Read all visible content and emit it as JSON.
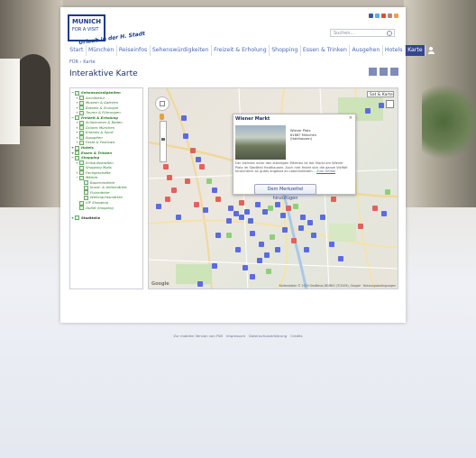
{
  "brand": {
    "logo_line1": "MUNICH",
    "logo_line2": "FOR A VISIT",
    "slogan": "Urlaub in der H. Stadt"
  },
  "colors": {
    "brand_blue": "#33478f",
    "link_blue": "#4b67b5",
    "tree_green": "#2a7a2a",
    "marker_blue": "#5b6be0",
    "marker_red": "#e0625a",
    "marker_green": "#8fce7a"
  },
  "social": [
    "facebook-icon",
    "twitter-icon",
    "googleplus-icon",
    "xing-icon",
    "rss-icon"
  ],
  "search": {
    "placeholder": "Suchen..."
  },
  "nav": {
    "items": [
      "Start",
      "München",
      "Reiseinfos",
      "Sehenswürdigkeiten",
      "Freizeit & Erholung",
      "Shopping",
      "Essen & Trinken",
      "Ausgehen",
      "Hotels",
      "Karte"
    ],
    "active": "Karte"
  },
  "breadcrumb": "FÜR › Karte",
  "page_title": "Interaktive Karte",
  "tree": [
    {
      "label": "Sehenswürdigkeiten",
      "level": 0,
      "toggle": "−"
    },
    {
      "label": "Architektur",
      "level": 1,
      "toggle": "+"
    },
    {
      "label": "Museen & Galerien",
      "level": 1,
      "toggle": "+"
    },
    {
      "label": "Botanik & Zoologie",
      "level": 1,
      "toggle": "+"
    },
    {
      "label": "Touren & Führungen",
      "level": 1,
      "toggle": "+"
    },
    {
      "label": "Freizeit & Erholung",
      "level": 0,
      "toggle": "−"
    },
    {
      "label": "Schwimmen & Baden",
      "level": 1,
      "toggle": "+"
    },
    {
      "label": "Grünes München",
      "level": 1,
      "toggle": "+"
    },
    {
      "label": "Erlebnis & Sport",
      "level": 1,
      "toggle": "+"
    },
    {
      "label": "Ausspiten",
      "level": 1,
      "toggle": "+"
    },
    {
      "label": "Feste & Festivals",
      "level": 1,
      "toggle": "+"
    },
    {
      "label": "Hotels",
      "level": 0,
      "toggle": "+"
    },
    {
      "label": "Essen & Trinken",
      "level": 0,
      "toggle": "+"
    },
    {
      "label": "Shopping",
      "level": 0,
      "toggle": "−"
    },
    {
      "label": "Einkaufsstraßen",
      "level": 1,
      "toggle": "+"
    },
    {
      "label": "Shopping Malls",
      "level": 1,
      "toggle": ""
    },
    {
      "label": "Fachgeschäfte",
      "level": 1,
      "toggle": "+"
    },
    {
      "label": "Märkte",
      "level": 1,
      "toggle": "−"
    },
    {
      "label": "Bauernmärkte",
      "level": 2,
      "toggle": ""
    },
    {
      "label": "Kunst- & Antikmärkte",
      "level": 2,
      "toggle": ""
    },
    {
      "label": "Flohmärkte",
      "level": 2,
      "toggle": ""
    },
    {
      "label": "Weihnachtsmärkte",
      "level": 2,
      "toggle": ""
    },
    {
      "label": "VIP Shopping",
      "level": 1,
      "toggle": ""
    },
    {
      "label": "Outlet Shopping",
      "level": 1,
      "toggle": ""
    },
    {
      "label": "",
      "level": 0,
      "toggle": ""
    },
    {
      "label": "Stadtteile",
      "level": 0,
      "toggle": "+",
      "plain": true
    }
  ],
  "map": {
    "type_select": "Sat & Karte",
    "popup": {
      "title": "Wiener Markt",
      "close": "×",
      "address_1": "Wiener Platz",
      "address_2": "81667 München",
      "address_3": "(Haidhausen)",
      "description": "Der kleinste unter den ständigen Märkten ist der Markt am Wiener Platz im Stadtteil Haidhausen. Auch hier findet sich die ganze Vielfalt hinsichtlich an gutes angebot an Lebensmitteln...",
      "more_link": "Zum Artikel",
      "button": "Dem Merkzettel hinzufügen"
    },
    "google": "Google",
    "attribution": "Kartendaten © 2019 GeoBasis-DE/BKG (©2009), Google · Nutzungsbedingungen"
  },
  "footer": [
    "Zur mobilen Version von FWI",
    "Impressum",
    "Datenschutzerklärung",
    "Credits"
  ]
}
